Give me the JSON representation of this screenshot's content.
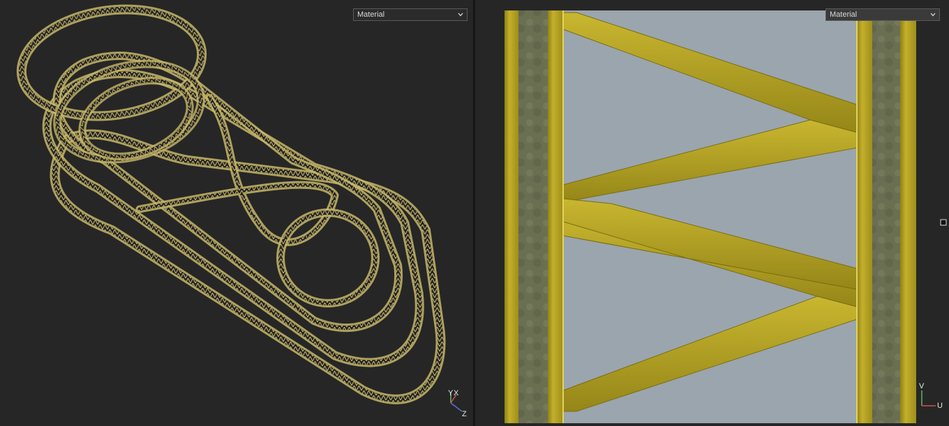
{
  "viewports": {
    "left": {
      "shading_mode": "Material",
      "axes": {
        "a": "Y",
        "b": "X",
        "c": "Z"
      }
    },
    "right": {
      "shading_mode": "Material",
      "axes": {
        "a": "V",
        "b": "U"
      }
    }
  },
  "icons": {
    "dropdown": "chevron-down-icon",
    "axis": "axis-gizmo-icon",
    "handle": "move-handle-icon"
  },
  "colors": {
    "viewport_bg": "#262626",
    "truss_wire": "#c7b768",
    "truss_yellow": "#b7a526",
    "truss_yellow_dark": "#8f8118",
    "concrete": "#6f7355",
    "panel_sky": "#9aa5ae"
  }
}
